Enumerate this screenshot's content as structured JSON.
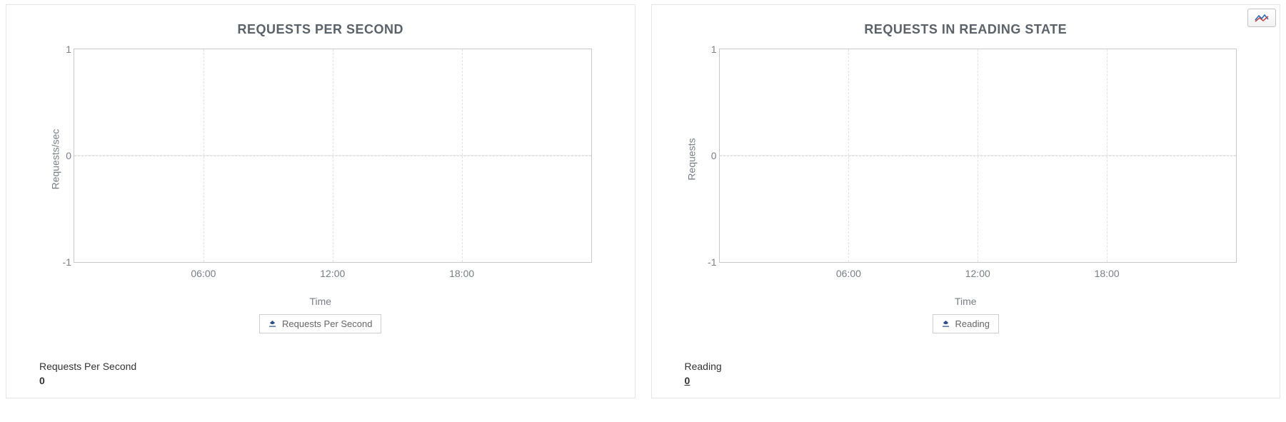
{
  "toolbar": {
    "chart_options_title": "Chart options"
  },
  "panels": [
    {
      "title": "REQUESTS PER SECOND",
      "ylabel": "Requests/sec",
      "xlabel": "Time",
      "legend": "Requests Per Second",
      "stat_label": "Requests Per Second",
      "stat_value": "0",
      "stat_underlined": false,
      "yticks": [
        "1",
        "0",
        "-1"
      ],
      "xticks": [
        "06:00",
        "12:00",
        "18:00"
      ]
    },
    {
      "title": "REQUESTS IN READING STATE",
      "ylabel": "Requests",
      "xlabel": "Time",
      "legend": "Reading",
      "stat_label": "Reading",
      "stat_value": "0",
      "stat_underlined": true,
      "yticks": [
        "1",
        "0",
        "-1"
      ],
      "xticks": [
        "06:00",
        "12:00",
        "18:00"
      ]
    }
  ],
  "chart_data": [
    {
      "type": "line",
      "title": "REQUESTS PER SECOND",
      "xlabel": "Time",
      "ylabel": "Requests/sec",
      "ylim": [
        -1,
        1
      ],
      "x": [
        "06:00",
        "12:00",
        "18:00"
      ],
      "series": [
        {
          "name": "Requests Per Second",
          "values": []
        }
      ]
    },
    {
      "type": "line",
      "title": "REQUESTS IN READING STATE",
      "xlabel": "Time",
      "ylabel": "Requests",
      "ylim": [
        -1,
        1
      ],
      "x": [
        "06:00",
        "12:00",
        "18:00"
      ],
      "series": [
        {
          "name": "Reading",
          "values": []
        }
      ]
    }
  ]
}
